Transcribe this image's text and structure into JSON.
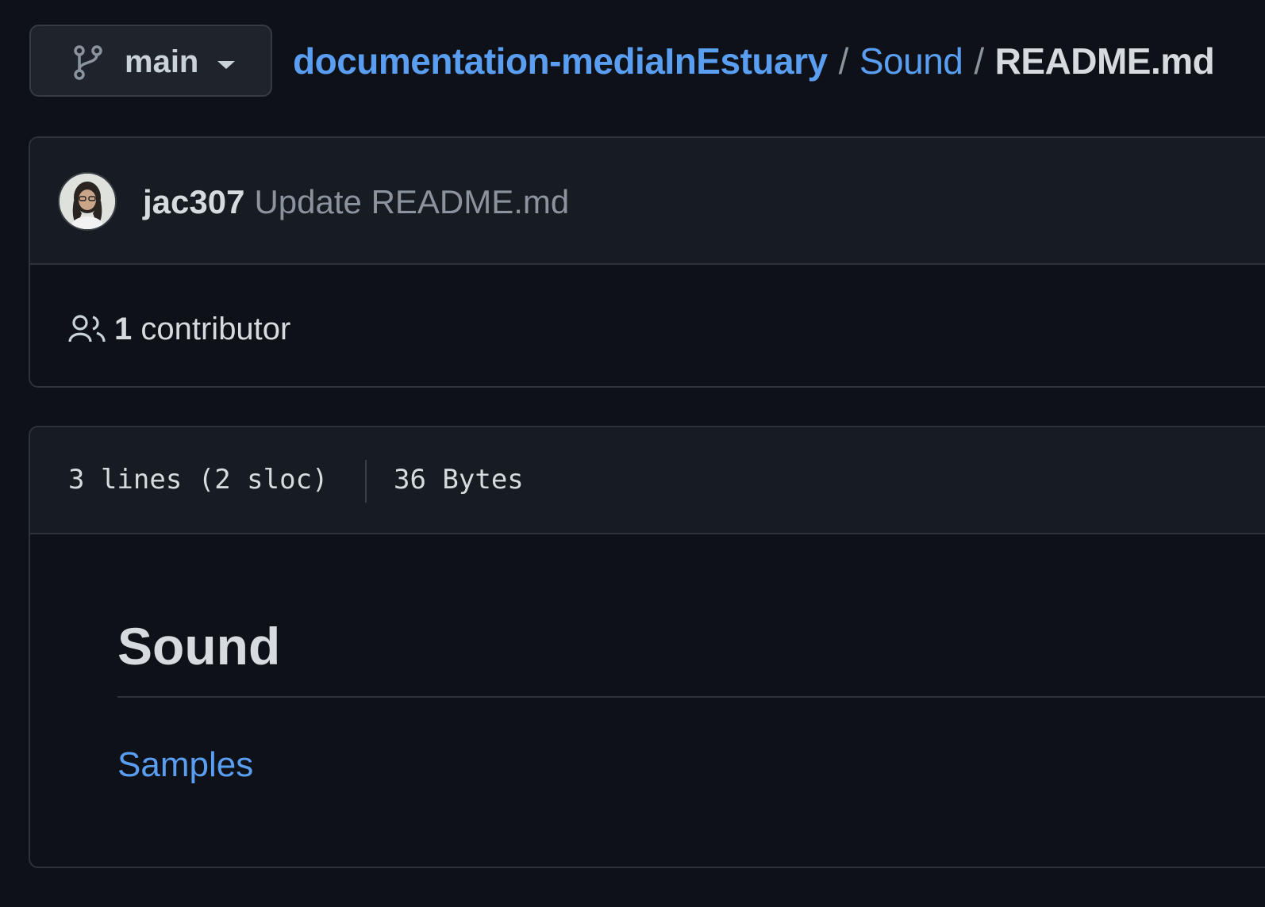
{
  "branch": {
    "icon": "git-branch-icon",
    "label": "main",
    "caret_icon": "caret-down-icon"
  },
  "breadcrumb": {
    "repo": "documentation-mediaInEstuary",
    "folder": "Sound",
    "separator": "/",
    "file": "README.md"
  },
  "commit": {
    "avatar_icon": "user-avatar",
    "author": "jac307",
    "message": "Update README.md"
  },
  "contributors": {
    "icon": "people-icon",
    "count": "1",
    "label": "contributor"
  },
  "file_info": {
    "lines": "3 lines (2 sloc)",
    "size": "36 Bytes"
  },
  "readme": {
    "heading": "Sound",
    "link": "Samples"
  },
  "colors": {
    "background": "#0e1117",
    "header_background": "#171b22",
    "link": "#5a9ef2",
    "border": "#2e333a"
  }
}
